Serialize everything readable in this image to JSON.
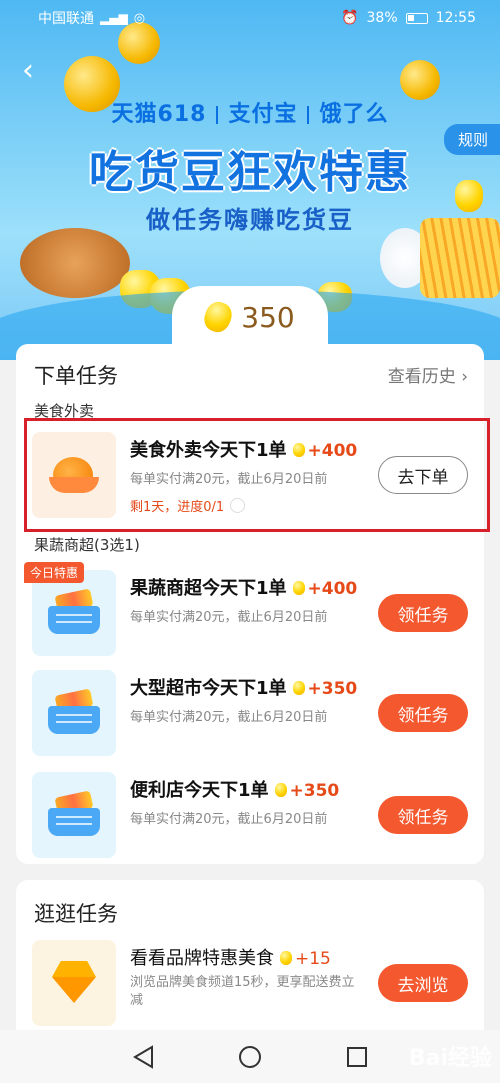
{
  "status_bar": {
    "carrier": "中国联通",
    "battery": "38%",
    "time": "12:55"
  },
  "banner": {
    "brands": [
      "天猫618",
      "支付宝",
      "饿了么"
    ],
    "headline": "吃货豆狂欢特惠",
    "subline": "做任务嗨赚吃货豆",
    "rules_label": "规则"
  },
  "points": {
    "value": "350"
  },
  "order_section": {
    "title": "下单任务",
    "history_label": "查看历史 ›",
    "food_delivery_label": "美食外卖",
    "grocery_label": "果蔬商超(3选1)",
    "today_tag": "今日特惠",
    "tasks": [
      {
        "title": "美食外卖今天下1单",
        "points": "+400",
        "desc": "每单实付满20元，截止6月20日前",
        "progress": "剩1天，进度0/1",
        "button": "去下单"
      },
      {
        "title": "果蔬商超今天下1单",
        "points": "+400",
        "desc": "每单实付满20元，截止6月20日前",
        "button": "领任务"
      },
      {
        "title": "大型超市今天下1单",
        "points": "+350",
        "desc": "每单实付满20元，截止6月20日前",
        "button": "领任务"
      },
      {
        "title": "便利店今天下1单",
        "points": "+350",
        "desc": "每单实付满20元，截止6月20日前",
        "button": "领任务"
      }
    ]
  },
  "browse_section": {
    "title": "逛逛任务",
    "tasks": [
      {
        "title": "看看品牌特惠美食",
        "points": "+15",
        "desc": "浏览品牌美食频道15秒，更享配送费立减",
        "button": "去浏览"
      }
    ]
  },
  "watermark": "Bai经验",
  "colors": {
    "accent": "#f4582f",
    "points_text": "#e64a19",
    "banner_blue": "#1273e0",
    "highlight": "#d8202a"
  },
  "icons": [
    "back-arrow-icon",
    "signal-icon",
    "wifi-icon",
    "alarm-icon",
    "battery-icon",
    "bean-icon",
    "food-bowl-icon",
    "basket-icon",
    "diamond-icon",
    "nav-back-icon",
    "nav-home-icon",
    "nav-recents-icon"
  ]
}
